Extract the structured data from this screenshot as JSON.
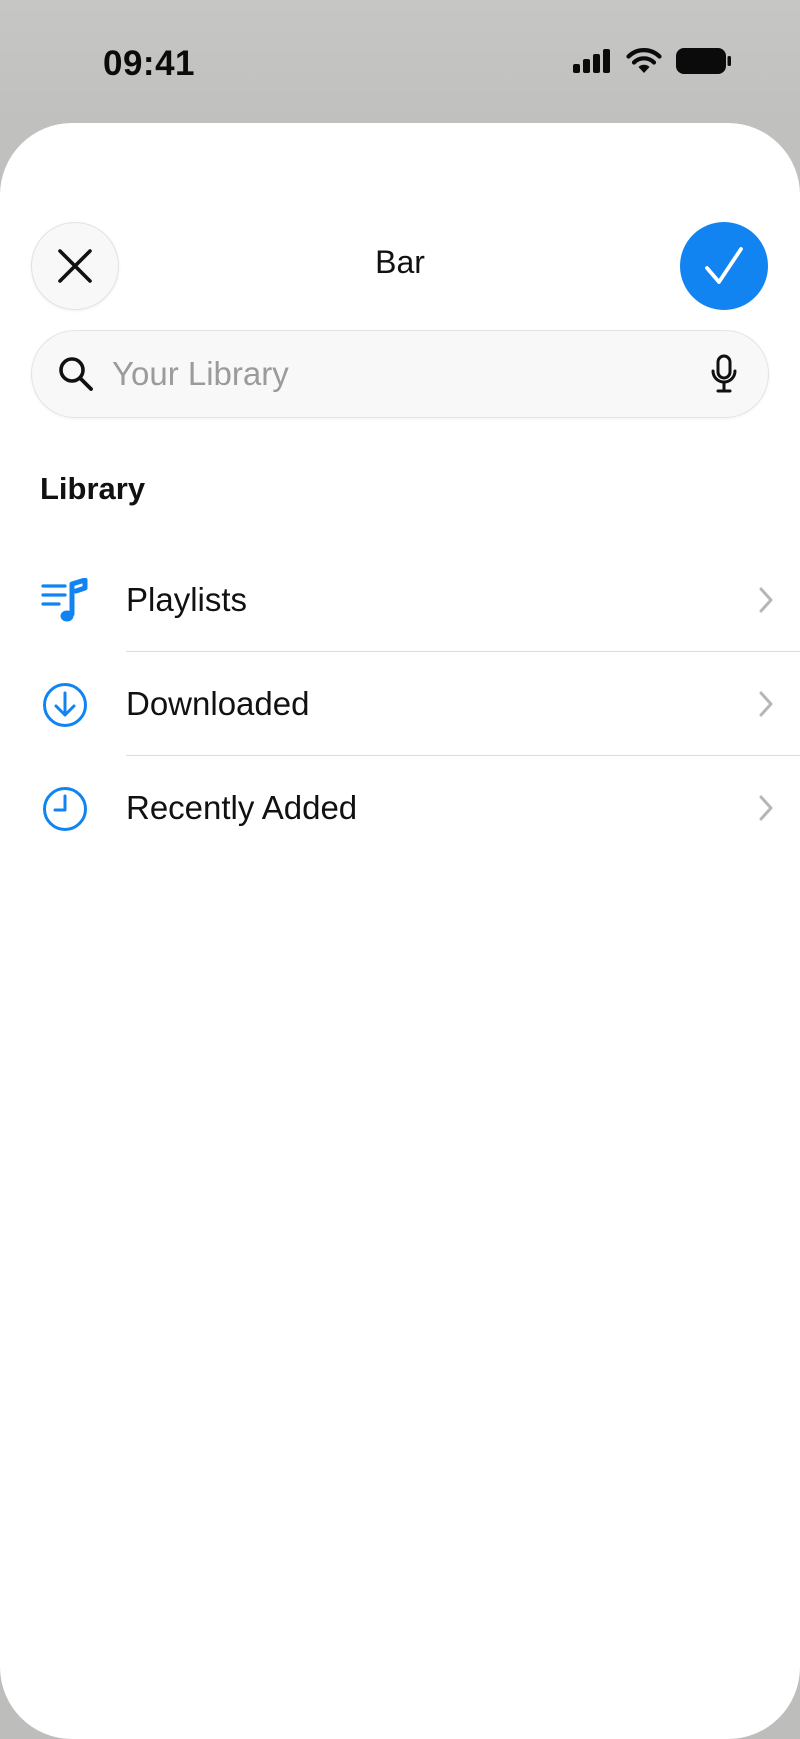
{
  "status_bar": {
    "time": "09:41"
  },
  "sheet": {
    "title": "Bar",
    "close_icon": "close-icon",
    "done_icon": "checkmark-icon"
  },
  "search": {
    "placeholder": "Your Library",
    "value": ""
  },
  "library": {
    "section_title": "Library",
    "items": [
      {
        "label": "Playlists",
        "icon": "playlists-icon"
      },
      {
        "label": "Downloaded",
        "icon": "download-icon"
      },
      {
        "label": "Recently Added",
        "icon": "clock-icon"
      }
    ]
  },
  "colors": {
    "accent": "#1184f1",
    "background": "#c6c7c5",
    "sheet": "#ffffff"
  }
}
